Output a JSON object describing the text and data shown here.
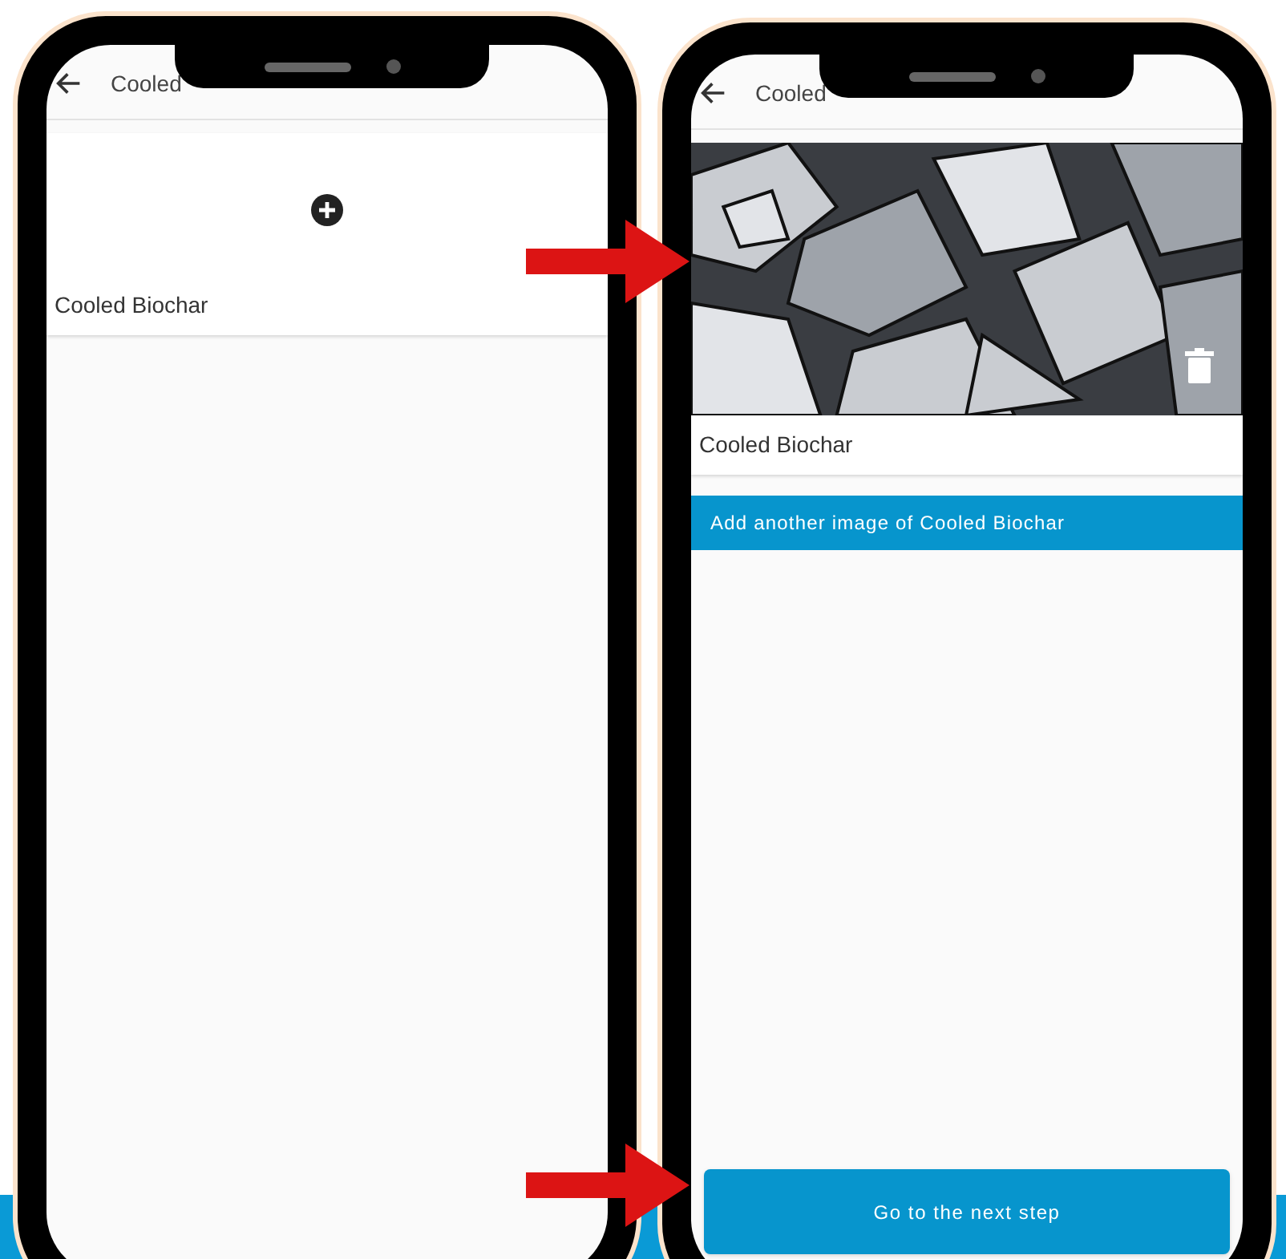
{
  "screens": [
    {
      "title": "Cooled",
      "card": {
        "kind": "empty",
        "label": "Cooled Biochar"
      }
    },
    {
      "title": "Cooled",
      "card": {
        "label": "Cooled Biochar"
      },
      "add_button": "Add another image of Cooled Biochar",
      "next_button": "Go to the next step"
    }
  ]
}
